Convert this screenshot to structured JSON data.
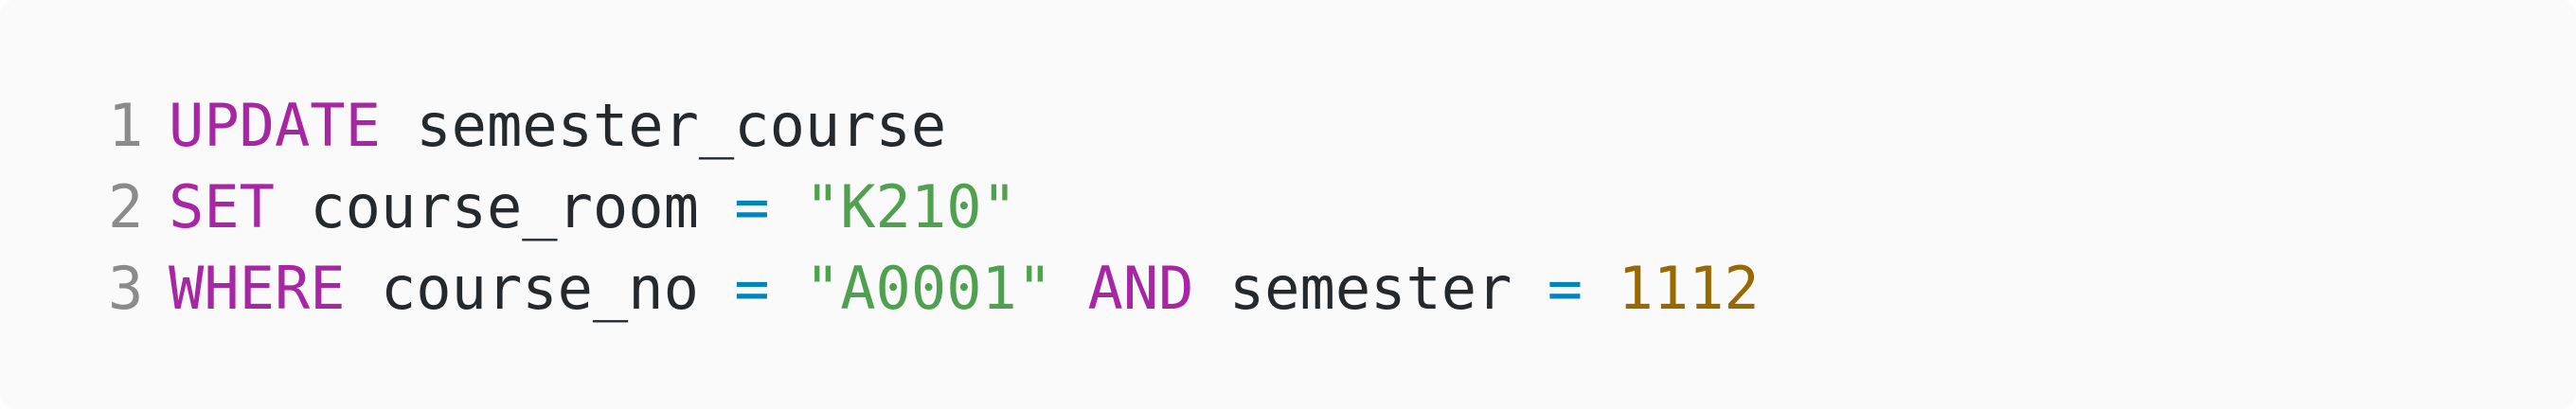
{
  "code": {
    "language": "sql",
    "lines": [
      {
        "number": "1",
        "tokens": [
          {
            "text": "UPDATE",
            "type": "keyword"
          },
          {
            "text": " ",
            "type": "space"
          },
          {
            "text": "semester_course",
            "type": "identifier"
          }
        ]
      },
      {
        "number": "2",
        "tokens": [
          {
            "text": "SET",
            "type": "keyword"
          },
          {
            "text": " ",
            "type": "space"
          },
          {
            "text": "course_room",
            "type": "identifier"
          },
          {
            "text": " ",
            "type": "space"
          },
          {
            "text": "=",
            "type": "operator"
          },
          {
            "text": " ",
            "type": "space"
          },
          {
            "text": "\"K210\"",
            "type": "string"
          }
        ]
      },
      {
        "number": "3",
        "tokens": [
          {
            "text": "WHERE",
            "type": "keyword"
          },
          {
            "text": " ",
            "type": "space"
          },
          {
            "text": "course_no",
            "type": "identifier"
          },
          {
            "text": " ",
            "type": "space"
          },
          {
            "text": "=",
            "type": "operator"
          },
          {
            "text": " ",
            "type": "space"
          },
          {
            "text": "\"A0001\"",
            "type": "string"
          },
          {
            "text": " ",
            "type": "space"
          },
          {
            "text": "AND",
            "type": "keyword"
          },
          {
            "text": " ",
            "type": "space"
          },
          {
            "text": "semester",
            "type": "identifier"
          },
          {
            "text": " ",
            "type": "space"
          },
          {
            "text": "=",
            "type": "operator"
          },
          {
            "text": " ",
            "type": "space"
          },
          {
            "text": "1112",
            "type": "number"
          }
        ]
      }
    ]
  },
  "colors": {
    "background": "#fafafa",
    "line_number": "#8b8b8b",
    "keyword": "#a626a4",
    "identifier": "#24292e",
    "operator": "#0184bc",
    "string": "#50a14f",
    "number": "#986801"
  }
}
